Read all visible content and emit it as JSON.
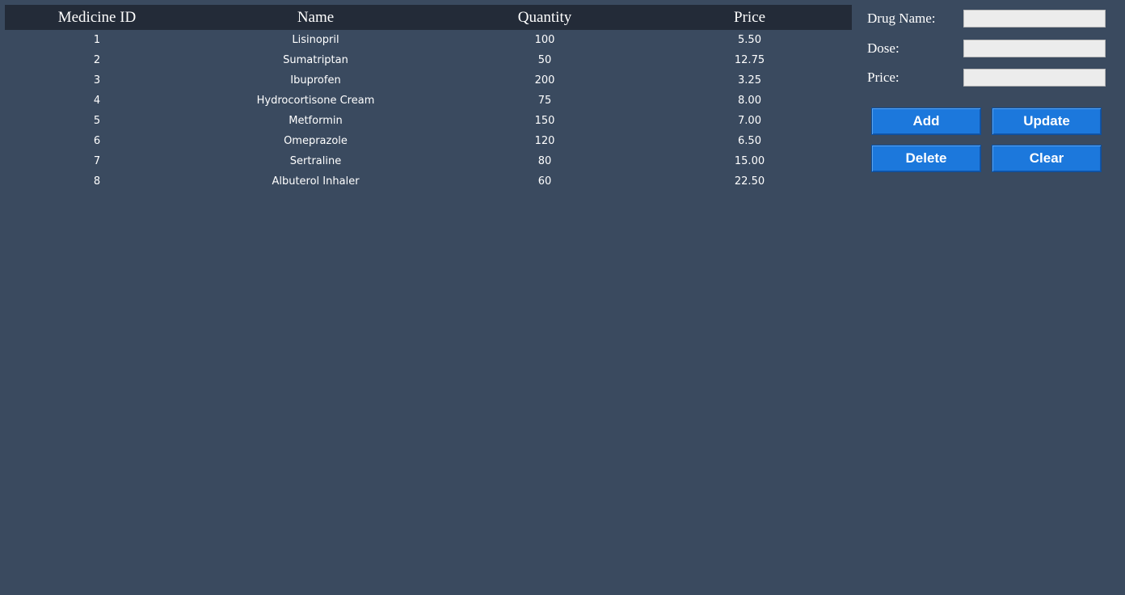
{
  "table": {
    "columns": [
      "Medicine ID",
      "Name",
      "Quantity",
      "Price"
    ],
    "rows": [
      [
        "1",
        "Lisinopril",
        "100",
        "5.50"
      ],
      [
        "2",
        "Sumatriptan",
        "50",
        "12.75"
      ],
      [
        "3",
        "Ibuprofen",
        "200",
        "3.25"
      ],
      [
        "4",
        "Hydrocortisone Cream",
        "75",
        "8.00"
      ],
      [
        "5",
        "Metformin",
        "150",
        "7.00"
      ],
      [
        "6",
        "Omeprazole",
        "120",
        "6.50"
      ],
      [
        "7",
        "Sertraline",
        "80",
        "15.00"
      ],
      [
        "8",
        "Albuterol Inhaler",
        "60",
        "22.50"
      ]
    ]
  },
  "form": {
    "drug_name_label": "Drug Name:",
    "drug_name_value": "",
    "dose_label": "Dose:",
    "dose_value": "",
    "price_label": "Price:",
    "price_value": ""
  },
  "buttons": {
    "add": "Add",
    "update": "Update",
    "delete": "Delete",
    "clear": "Clear"
  },
  "colors": {
    "background": "#3a4a5f",
    "header_bg": "#232b38",
    "button_bg": "#1c78dc",
    "input_bg": "#ececec"
  }
}
